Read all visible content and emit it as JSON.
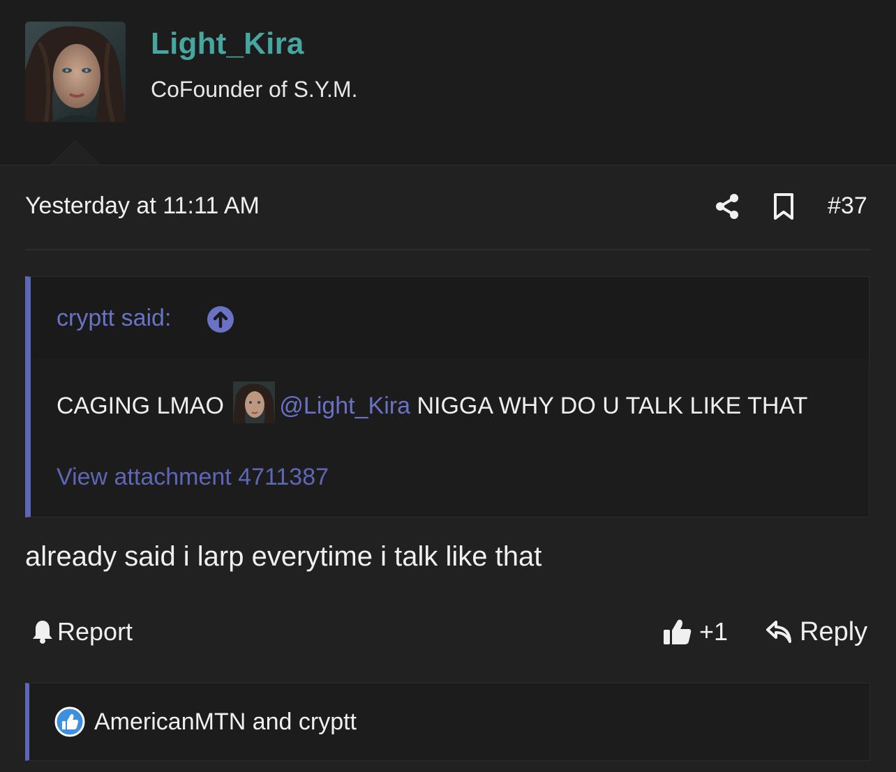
{
  "user": {
    "name": "Light_Kira",
    "title": "CoFounder of S.Y.M."
  },
  "post": {
    "date": "Yesterday at 11:11 AM",
    "number": "#37",
    "text": "already said i larp everytime i talk like that"
  },
  "quote": {
    "author_label": "cryptt said:",
    "body_before": "CAGING LMAO",
    "mention": "@Light_Kira",
    "body_after": "NIGGA WHY DO U TALK LIKE THAT",
    "attachment_link": "View attachment 4711387"
  },
  "actions": {
    "report_label": "Report",
    "like_label": "+1",
    "reply_label": "Reply"
  },
  "reactions": {
    "text": "AmericanMTN and cryptt"
  },
  "icons": {
    "share": "share-icon",
    "bookmark": "bookmark-icon",
    "quote_jump": "arrow-up-circle-icon",
    "report": "bell-icon",
    "like": "thumbs-up-icon",
    "reply": "reply-arrow-icon",
    "reaction": "like-reaction-icon"
  },
  "colors": {
    "username": "#47a7a0",
    "link": "#6a72c4",
    "accent_bar": "#5e67b5",
    "background": "#212121"
  }
}
